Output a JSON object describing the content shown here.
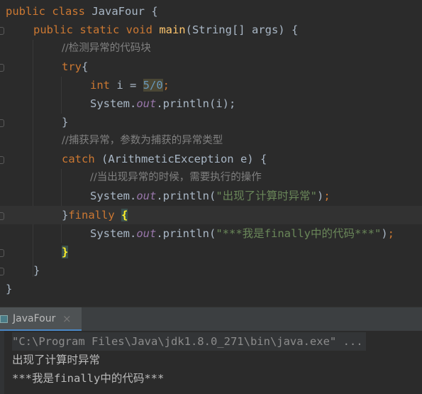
{
  "editor": {
    "colors": {
      "background": "#2b2b2b",
      "keyword": "#cc7832",
      "comment": "#808080",
      "number": "#6897bb",
      "string": "#6a8759",
      "static_field": "#9876aa",
      "plain": "#a9b7c6",
      "brace_match": "#ffef28"
    },
    "lines": [
      {
        "kw1": "public class ",
        "rest": "JavaFour {"
      },
      {
        "kw1": "public static void ",
        "fn": "main",
        "rest": "(String[] args) {"
      },
      {
        "comment": "//检测异常的代码块"
      },
      {
        "kw1": "try",
        "rest": "{"
      },
      {
        "kw1": "int ",
        "pre": "i = ",
        "num": "5/0",
        "semi": ";"
      },
      {
        "pre": "System.",
        "field": "out",
        "rest": ".println(i);"
      },
      {
        "rest": "}"
      },
      {
        "comment": "//捕获异常，参数为捕获的异常类型"
      },
      {
        "kw1": "catch ",
        "rest": "(ArithmeticException e) {"
      },
      {
        "comment": "//当出现异常的时候，需要执行的操作"
      },
      {
        "pre": "System.",
        "field": "out",
        "mid": ".println(",
        "str": "\"出现了计算时异常\"",
        "post": ")",
        "semi": ";"
      },
      {
        "pre": "}",
        "kw1": "finally ",
        "brace": "{"
      },
      {
        "pre": "System.",
        "field": "out",
        "mid": ".println(",
        "str": "\"***我是finally中的代码***\"",
        "post": ")",
        "semi": ";"
      },
      {
        "brace": "}"
      },
      {
        "rest": "}"
      },
      {
        "rest": "}"
      }
    ]
  },
  "run_panel": {
    "tab_label": "JavaFour",
    "close_icon": "×",
    "console": [
      "\"C:\\Program Files\\Java\\jdk1.8.0_271\\bin\\java.exe\" ...",
      "出现了计算时异常",
      "***我是finally中的代码***"
    ]
  }
}
